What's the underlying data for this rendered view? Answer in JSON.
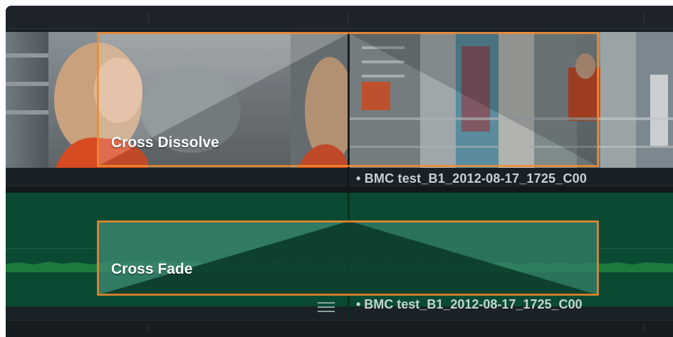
{
  "timeline": {
    "video_track": {
      "clip_label": "• BMC test_B1_2012-08-17_1725_C00",
      "transition_label": "Cross Dissolve"
    },
    "audio_track": {
      "clip_label": "• BMC test_B1_2012-08-17_1725_C00",
      "transition_label": "Cross Fade",
      "menu_icon": "hamburger-icon"
    },
    "colors": {
      "selection": "#f08a2c",
      "video_bg": "#1a2126",
      "audio_bg": "#0a4a33",
      "waveform": "#1c7a3e"
    }
  }
}
